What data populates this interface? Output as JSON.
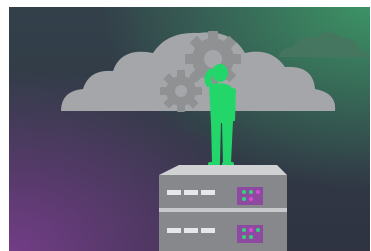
{
  "illustration": {
    "colors": {
      "background_top": "#33404a",
      "background_bottom": "#2f3342",
      "glow_green": "#3fae6e",
      "glow_purple": "#7a3e8e",
      "cloud": "#a4a6a9",
      "cloud_small": "#47755f",
      "gear": "#8f9193",
      "person": "#22d66a",
      "server_top": "#d0d1d3",
      "server_front": "#86888b",
      "server_slot": "#e6e7e8",
      "led_green": "#36d27a",
      "led_pink": "#d84ad8",
      "led_panel": "#8d4aa0"
    },
    "icons": [
      "cloud-icon",
      "gear-icon",
      "person-icon",
      "server-icon"
    ]
  }
}
